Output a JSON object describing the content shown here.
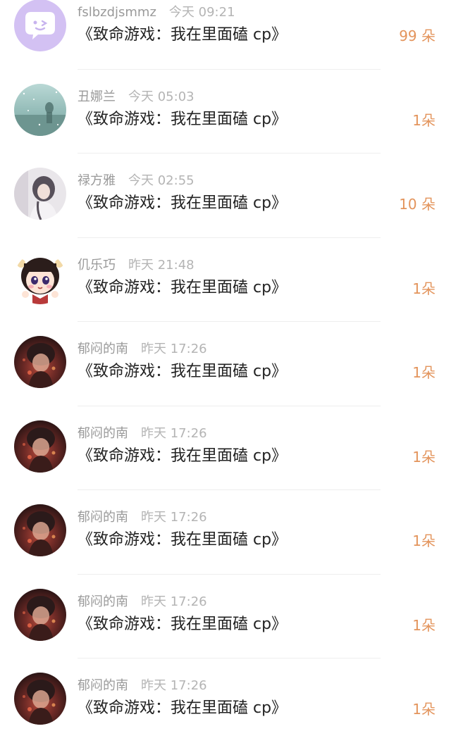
{
  "colors": {
    "count": "#e3945c",
    "username": "#9a9a9a",
    "title": "#222222"
  },
  "gifts": [
    {
      "user": "fslbzdjsmmz",
      "time": "今天 09:21",
      "title": "《致命游戏：我在里面磕 cp》",
      "count": "99 朵",
      "avatar": "purple-chat-avatar"
    },
    {
      "user": "丑娜兰",
      "time": "今天 05:03",
      "title": "《致命游戏：我在里面磕 cp》",
      "count": "1朵",
      "avatar": "teal-landscape-avatar"
    },
    {
      "user": "禄方雅",
      "time": "今天 02:55",
      "title": "《致命游戏：我在里面磕 cp》",
      "count": "10 朵",
      "avatar": "girl-photo-avatar"
    },
    {
      "user": "仉乐巧",
      "time": "昨天 21:48",
      "title": "《致命游戏：我在里面磕 cp》",
      "count": "1朵",
      "avatar": "cartoon-girl-avatar"
    },
    {
      "user": "郁闷的南",
      "time": "昨天 17:26",
      "title": "《致命游戏：我在里面磕 cp》",
      "count": "1朵",
      "avatar": "dark-anime-avatar"
    },
    {
      "user": "郁闷的南",
      "time": "昨天 17:26",
      "title": "《致命游戏：我在里面磕 cp》",
      "count": "1朵",
      "avatar": "dark-anime-avatar"
    },
    {
      "user": "郁闷的南",
      "time": "昨天 17:26",
      "title": "《致命游戏：我在里面磕 cp》",
      "count": "1朵",
      "avatar": "dark-anime-avatar"
    },
    {
      "user": "郁闷的南",
      "time": "昨天 17:26",
      "title": "《致命游戏：我在里面磕 cp》",
      "count": "1朵",
      "avatar": "dark-anime-avatar"
    },
    {
      "user": "郁闷的南",
      "time": "昨天 17:26",
      "title": "《致命游戏：我在里面磕 cp》",
      "count": "1朵",
      "avatar": "dark-anime-avatar"
    }
  ]
}
